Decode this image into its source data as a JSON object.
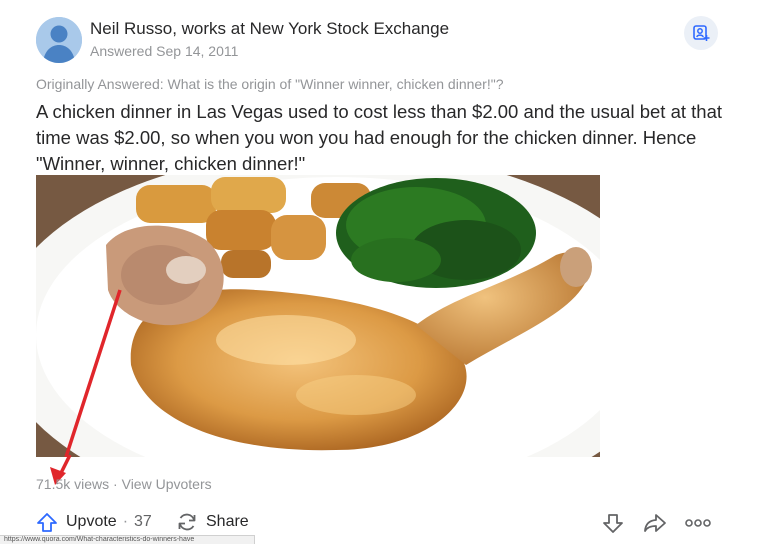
{
  "author": {
    "name_line": "Neil Russo, works at New York Stock Exchange",
    "answered": "Answered Sep 14, 2011"
  },
  "question": {
    "originally_answered": "Originally Answered: What is the origin of \"Winner winner, chicken dinner!\"?"
  },
  "answer": {
    "text": "A chicken dinner in Las Vegas used to cost less than $2.00 and the usual bet at that time was $2.00, so when you won you had enough for the chicken dinner. Hence \"Winner, winner, chicken dinner!\""
  },
  "image": {
    "icon": "chicken-dinner-photo"
  },
  "stats": {
    "views": "71.5k views",
    "separator": " · ",
    "upvoters_link": "View Upvoters"
  },
  "actions": {
    "upvote_label": "Upvote",
    "upvote_separator": "·",
    "upvote_count": "37",
    "share_label": "Share",
    "icons": [
      "upvote-icon",
      "share-refresh-icon",
      "downvote-icon",
      "forward-icon",
      "more-icon",
      "share-person-icon"
    ]
  },
  "status_bar": {
    "url": "https://www.quora.com/What-characteristics-do-winners-have"
  },
  "colors": {
    "text": "#282829",
    "muted": "#939598",
    "accent": "#2e69ff",
    "annotation_arrow": "#e0262b"
  }
}
